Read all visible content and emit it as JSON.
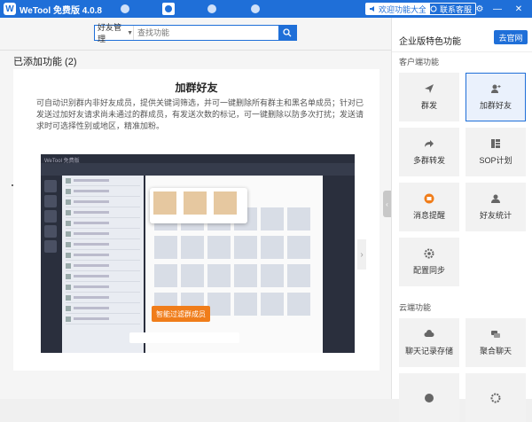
{
  "titlebar": {
    "app_title": "WeTool 免费版 4.0.8",
    "btn_all_features": "欢迎功能大全",
    "btn_contact": "联系客服",
    "nav_icons": [
      "wechat-icon",
      "user-card-icon",
      "robot-icon",
      "contact-icon"
    ]
  },
  "search": {
    "category": "好友管理",
    "placeholder": "查找功能"
  },
  "main": {
    "added_title": "已添加功能 (2)",
    "card": {
      "title": "加群好友",
      "description": "可自动识别群内非好友成员，提供关键词筛选，并可一键删除所有群主和黑名单成员；针对已发送过加好友请求尚未通过的群成员，有发送次数的标记，可一键删除以防多次打扰；发送请求时可选择性别或地区，精准加粉。",
      "preview_button": "智能过滤群成员",
      "preview_window_title": "WeTool 免费版"
    }
  },
  "right_panel": {
    "header": "企业版特色功能",
    "goto_button": "去官网",
    "client_section": "客户端功能",
    "client_tiles": [
      {
        "label": "群发",
        "icon": "paper-plane-icon"
      },
      {
        "label": "加群好友",
        "icon": "add-user-icon"
      },
      {
        "label": "多群转发",
        "icon": "forward-icon"
      },
      {
        "label": "SOP计划",
        "icon": "sop-plan-icon"
      },
      {
        "label": "消息提醒",
        "icon": "message-alert-icon"
      },
      {
        "label": "好友统计",
        "icon": "friend-stats-icon"
      },
      {
        "label": "配置同步",
        "icon": "sync-config-icon"
      }
    ],
    "cloud_section": "云端功能",
    "cloud_tiles": [
      {
        "label": "聊天记录存储",
        "icon": "chat-cloud-icon"
      },
      {
        "label": "聚合聊天",
        "icon": "aggregate-chat-icon"
      }
    ]
  },
  "colors": {
    "accent": "#1f6fd8",
    "orange": "#f07d1a"
  }
}
